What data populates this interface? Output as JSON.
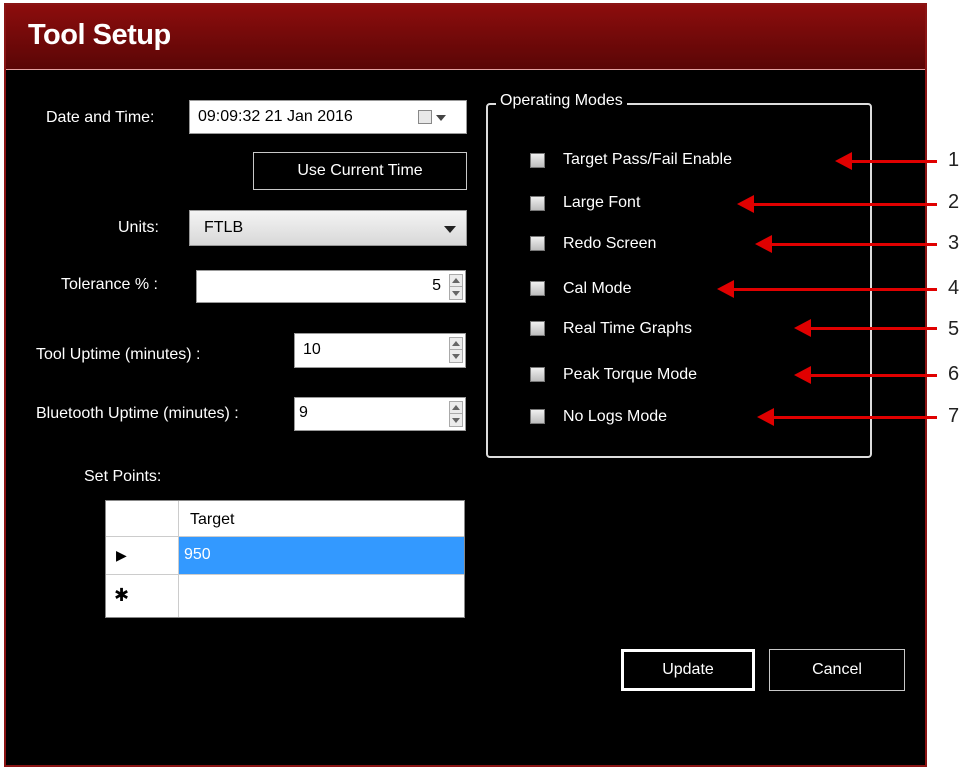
{
  "window": {
    "title": "Tool Setup"
  },
  "form": {
    "date_label": "Date and Time:",
    "date_value": "09:09:32 21 Jan  2016",
    "use_current_time_label": "Use Current Time",
    "units_label": "Units:",
    "units_value": "FTLB",
    "tolerance_label": "Tolerance % :",
    "tolerance_value": "5",
    "tool_uptime_label": "Tool Uptime (minutes) :",
    "tool_uptime_value": "10",
    "bluetooth_uptime_label": "Bluetooth Uptime (minutes) :",
    "bluetooth_uptime_value": "9",
    "set_points_label": "Set Points:"
  },
  "set_points_grid": {
    "column_header": "Target",
    "rows": [
      {
        "marker": "▶",
        "target": "950",
        "selected": true
      }
    ],
    "new_row_marker": "✱"
  },
  "operating_modes": {
    "title": "Operating Modes",
    "items": [
      {
        "label": "Target Pass/Fail Enable",
        "checked": false
      },
      {
        "label": "Large Font",
        "checked": false
      },
      {
        "label": "Redo Screen",
        "checked": false
      },
      {
        "label": "Cal Mode",
        "checked": false
      },
      {
        "label": "Real Time Graphs",
        "checked": false
      },
      {
        "label": "Peak Torque Mode",
        "checked": false
      },
      {
        "label": "No Logs Mode",
        "checked": false
      }
    ]
  },
  "annotations": [
    "1",
    "2",
    "3",
    "4",
    "5",
    "6",
    "7"
  ],
  "buttons": {
    "update": "Update",
    "cancel": "Cancel"
  },
  "colors": {
    "title_bar": "#7a0a0a",
    "annotation_arrow": "#e00000",
    "selection": "#3399ff"
  }
}
